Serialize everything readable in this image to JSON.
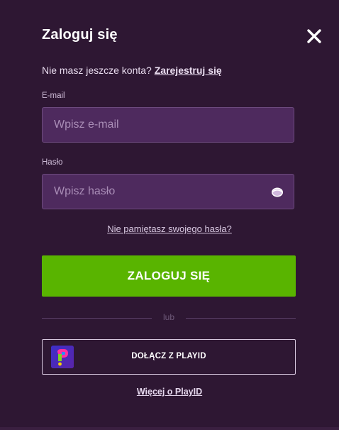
{
  "modal": {
    "title": "Zaloguj się",
    "no_account_text": "Nie masz jeszcze konta?",
    "register_link": "Zarejestruj się"
  },
  "email": {
    "label": "E-mail",
    "placeholder": "Wpisz e-mail",
    "value": ""
  },
  "password": {
    "label": "Hasło",
    "placeholder": "Wpisz hasło",
    "value": ""
  },
  "forgot_password": "Nie pamiętasz swojego hasła?",
  "login_button": "ZALOGUJ SIĘ",
  "divider_text": "lub",
  "playid": {
    "button_label": "DOŁĄCZ Z PLAYID",
    "more_link": "Więcej o PlayID"
  },
  "icons": {
    "close": "close-icon",
    "eye": "eye-icon",
    "playid_logo": "playid-logo"
  },
  "colors": {
    "background": "#2e1733",
    "input_bg": "#4e2a5e",
    "primary_button": "#59b400"
  }
}
